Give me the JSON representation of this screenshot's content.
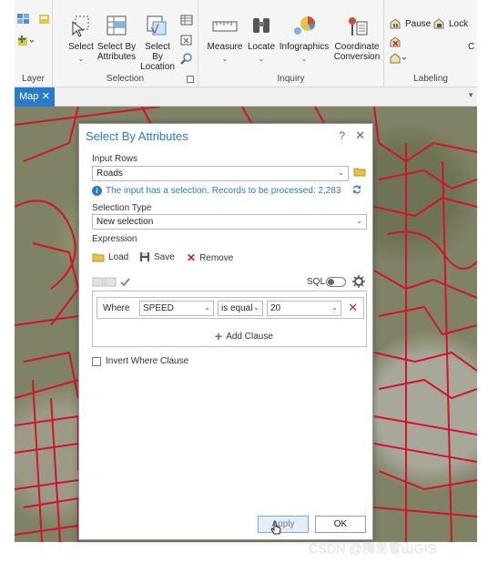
{
  "ribbon": {
    "groups": {
      "layer": "Layer",
      "selection": "Selection",
      "inquiry": "Inquiry",
      "labeling": "Labeling"
    },
    "buttons": {
      "select": "Select",
      "select_by_attributes": [
        "Select By",
        "Attributes"
      ],
      "select_by_location": [
        "Select By",
        "Location"
      ],
      "measure": "Measure",
      "locate": "Locate",
      "infographics": "Infographics",
      "coordinate_conversion": [
        "Coordinate",
        "Conversion"
      ],
      "pause": "Pause",
      "lock": "Lock",
      "clipped_partial": "C"
    }
  },
  "tab": {
    "label": "Map",
    "close": "✕"
  },
  "dialog": {
    "title": "Select By Attributes",
    "help": "?",
    "close": "✕",
    "input_rows_label": "Input Rows",
    "input_rows_value": "Roads",
    "info_text": "The input has a selection. Records to be processed: 2,283",
    "selection_type_label": "Selection Type",
    "selection_type_value": "New selection",
    "expression_label": "Expression",
    "actions": {
      "load": "Load",
      "save": "Save",
      "remove": "Remove"
    },
    "sql_label": "SQL",
    "clause": {
      "where": "Where",
      "field": "SPEED",
      "operator": "is equal",
      "value": "20"
    },
    "add_clause": "Add Clause",
    "invert_label": "Invert Where Clause",
    "apply": "Apply",
    "ok": "OK"
  },
  "watermark": "CSDN @梅里雪山GIS",
  "colors": {
    "accent": "#2a7bc9",
    "roads": "#d4122a",
    "remove_x": "#cc2222",
    "add_plus": "#3a8a3a"
  }
}
